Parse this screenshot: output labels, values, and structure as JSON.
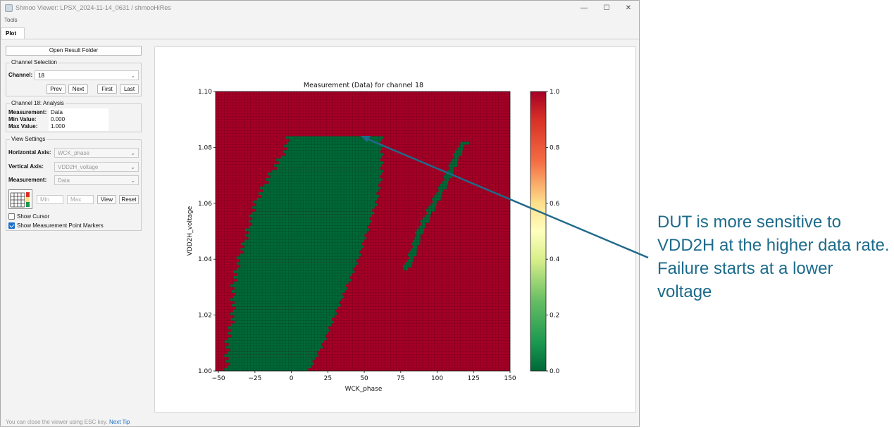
{
  "window": {
    "title": "Shmoo Viewer: LPSX_2024-11-14_0631 / shmooHiRes",
    "buttons": [
      "—",
      "☐",
      "✕"
    ]
  },
  "menu": {
    "tools": "Tools"
  },
  "tabs": {
    "plot": "Plot"
  },
  "sidebar": {
    "open_folder": "Open Result Folder",
    "channel_selection": {
      "title": "Channel Selection",
      "channel_label": "Channel:",
      "channel_value": "18",
      "prev": "Prev",
      "next": "Next",
      "first": "First",
      "last": "Last"
    },
    "analysis": {
      "title": "Channel 18: Analysis",
      "measurement_label": "Measurement:",
      "measurement_value": "Data",
      "min_label": "Min Value:",
      "min_value": "0.000",
      "max_label": "Max Value:",
      "max_value": "1.000"
    },
    "view_settings": {
      "title": "View Settings",
      "horizontal_label": "Horizontal Axis:",
      "horizontal_value": "WCK_phase",
      "vertical_label": "Vertical Axis:",
      "vertical_value": "VDD2H_voltage",
      "measurement_label": "Measurement:",
      "measurement_value": "Data",
      "min_placeholder": "Min",
      "max_placeholder": "Max",
      "view": "View",
      "reset": "Reset",
      "show_cursor": "Show Cursor",
      "show_cursor_checked": false,
      "show_markers": "Show Measurement Point Markers",
      "show_markers_checked": true
    }
  },
  "status": {
    "tip": "You can close the viewer using ESC key.",
    "next_tip": "Next Tip"
  },
  "annotation": "DUT is more sensitive to VDD2H at the higher data rate. Failure starts at a lower voltage",
  "chart_data": {
    "type": "heatmap",
    "title": "Measurement (Data) for channel 18",
    "xlabel": "WCK_phase",
    "ylabel": "VDD2H_voltage",
    "xlim": [
      -52,
      150
    ],
    "ylim": [
      1.0,
      1.1
    ],
    "x_ticks": [
      "−50",
      "−25",
      "0",
      "25",
      "50",
      "75",
      "100",
      "125",
      "150"
    ],
    "x_tick_values": [
      -50,
      -25,
      0,
      25,
      50,
      75,
      100,
      125,
      150
    ],
    "y_ticks": [
      "1.00",
      "1.02",
      "1.04",
      "1.06",
      "1.08",
      "1.10"
    ],
    "y_tick_values": [
      1.0,
      1.02,
      1.04,
      1.06,
      1.08,
      1.1
    ],
    "colorbar": {
      "min": 0.0,
      "max": 1.0,
      "ticks": [
        "0.0",
        "0.2",
        "0.4",
        "0.6",
        "0.8",
        "1.0"
      ],
      "colormap": "RdYlGn_r"
    },
    "pass_value": 0,
    "fail_value": 1,
    "colors": {
      "pass": "#006837",
      "fail": "#a50026"
    },
    "pass_region_left_edge": [
      [
        1.0,
        -44
      ],
      [
        1.01,
        -44
      ],
      [
        1.02,
        -40
      ],
      [
        1.03,
        -40
      ],
      [
        1.04,
        -36
      ],
      [
        1.05,
        -30
      ],
      [
        1.06,
        -25
      ],
      [
        1.07,
        -15
      ],
      [
        1.08,
        -3
      ],
      [
        1.084,
        -3
      ]
    ],
    "pass_region_right_edge": [
      [
        1.0,
        12
      ],
      [
        1.01,
        22
      ],
      [
        1.02,
        30
      ],
      [
        1.03,
        38
      ],
      [
        1.04,
        46
      ],
      [
        1.05,
        52
      ],
      [
        1.06,
        58
      ],
      [
        1.07,
        62
      ],
      [
        1.08,
        62
      ],
      [
        1.084,
        62
      ]
    ],
    "pass_island": [
      [
        1.036,
        78
      ],
      [
        1.04,
        82
      ],
      [
        1.05,
        88
      ],
      [
        1.06,
        98
      ],
      [
        1.07,
        108
      ],
      [
        1.08,
        116
      ],
      [
        1.082,
        120
      ]
    ]
  }
}
